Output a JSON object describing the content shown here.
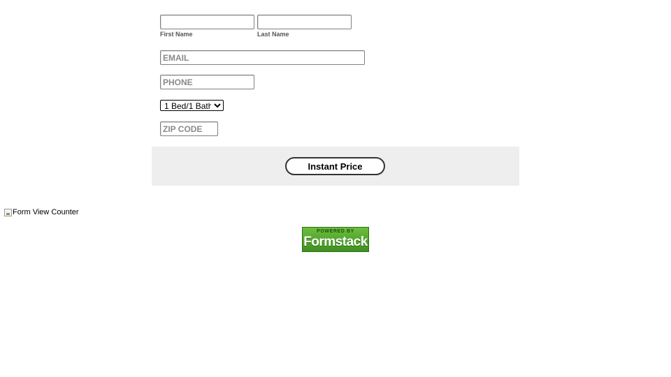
{
  "form": {
    "first_name": {
      "value": "",
      "sublabel": "First Name"
    },
    "last_name": {
      "value": "",
      "sublabel": "Last Name"
    },
    "email": {
      "placeholder": "EMAIL"
    },
    "phone": {
      "placeholder": "PHONE"
    },
    "unit_type": {
      "selected": "1 Bed/1 Bath",
      "options": [
        "1 Bed/1 Bath"
      ]
    },
    "zip": {
      "placeholder": "ZIP CODE"
    },
    "submit_label": "Instant Price"
  },
  "counter": {
    "alt_text": "Form View Counter"
  },
  "badge": {
    "powered_by": "POWERED BY",
    "brand": "Formstack",
    "colors": {
      "top": "#6cbf3c",
      "bottom": "#3f8f22"
    }
  }
}
